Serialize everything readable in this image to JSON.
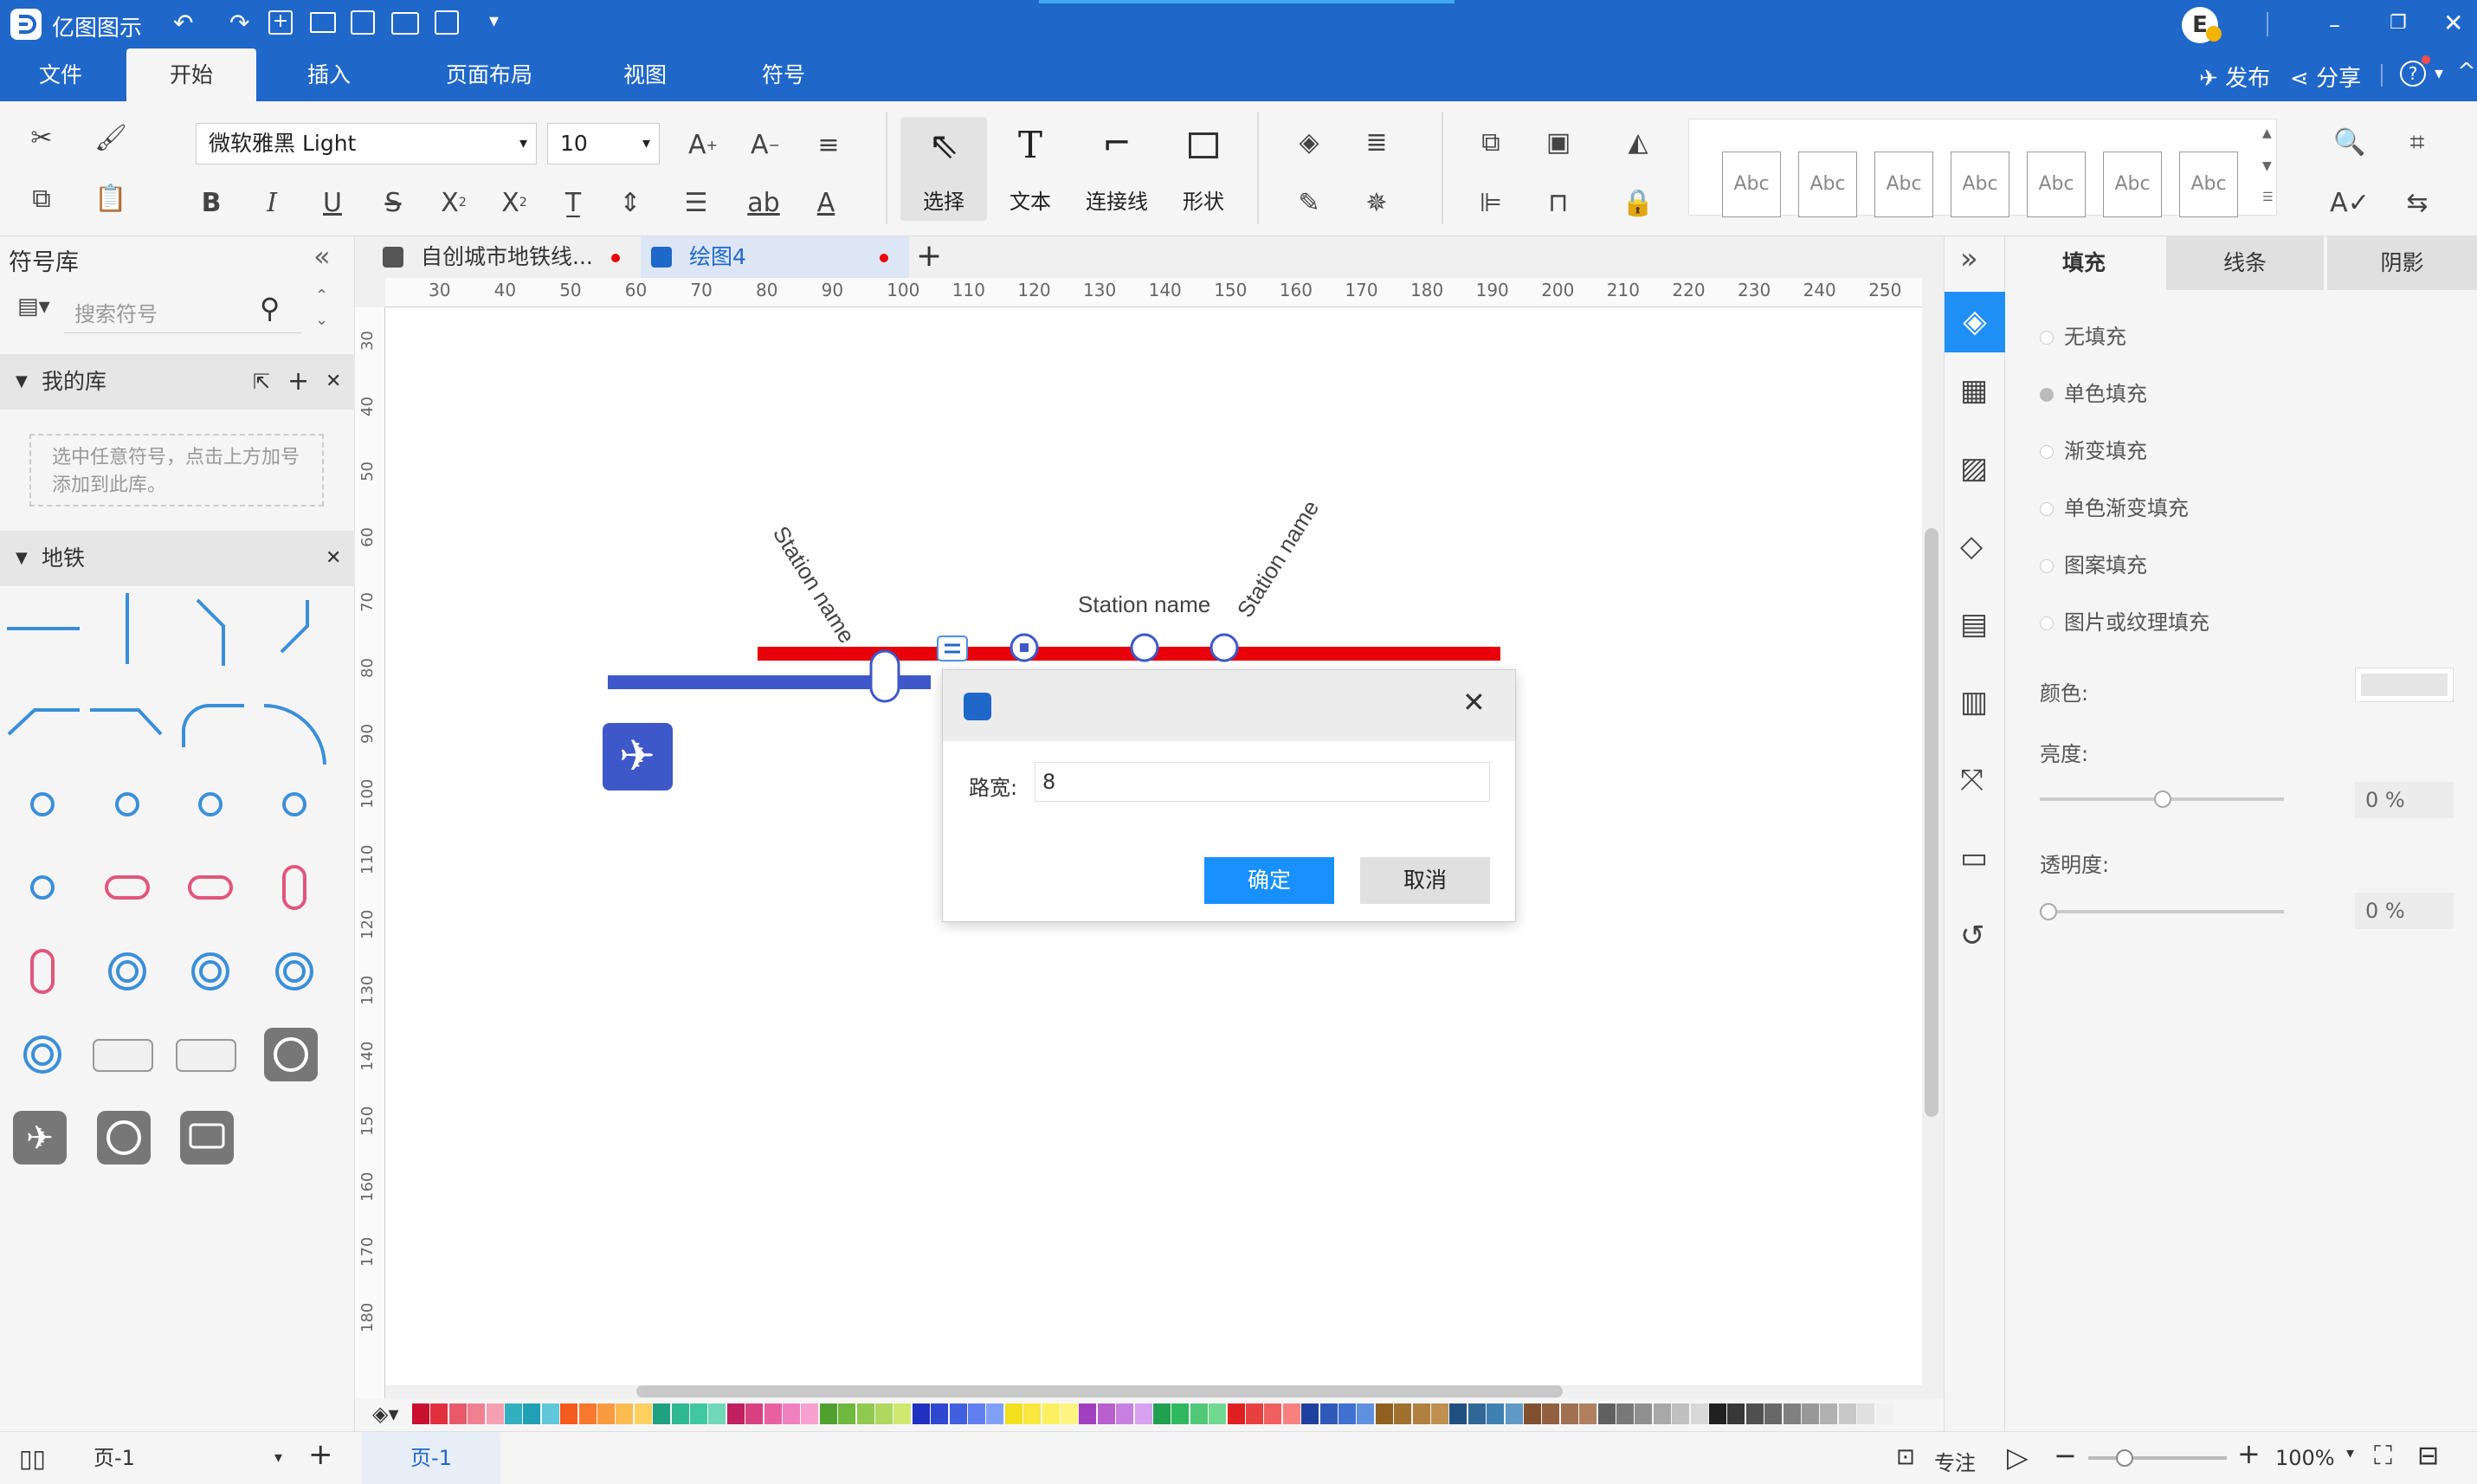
{
  "app": {
    "title": "亿图图示"
  },
  "user": {
    "initial": "E"
  },
  "menu": {
    "file": "文件",
    "tabs": [
      "开始",
      "插入",
      "页面布局",
      "视图",
      "符号"
    ],
    "publish": "发布",
    "share": "分享"
  },
  "toolbar": {
    "font": "微软雅黑 Light",
    "size": "10",
    "select": "选择",
    "text": "文本",
    "connector": "连接线",
    "shape": "形状",
    "styles": [
      "Abc",
      "Abc",
      "Abc",
      "Abc",
      "Abc",
      "Abc",
      "Abc"
    ]
  },
  "library": {
    "title": "符号库",
    "search_placeholder": "搜索符号",
    "my_library": "我的库",
    "my_library_hint": "选中任意符号，点击上方加号添加到此库。",
    "metro": "地铁"
  },
  "doc_tabs": [
    "自创城市地铁线...",
    "绘图4"
  ],
  "ruler": {
    "h": [
      "30",
      "40",
      "50",
      "60",
      "70",
      "80",
      "90",
      "100",
      "110",
      "120",
      "130",
      "140",
      "150",
      "160",
      "170",
      "180",
      "190",
      "200",
      "210",
      "220",
      "230",
      "240",
      "250"
    ],
    "v": [
      "30",
      "40",
      "50",
      "60",
      "70",
      "80",
      "90",
      "100",
      "110",
      "120",
      "130",
      "140",
      "150",
      "160",
      "170",
      "180"
    ]
  },
  "canvas": {
    "station_labels": [
      "Station name",
      "Station name",
      "Station name"
    ]
  },
  "dialog": {
    "field_label": "路宽:",
    "field_value": "8",
    "ok": "确定",
    "cancel": "取消"
  },
  "right_panel": {
    "tabs": [
      "填充",
      "线条",
      "阴影"
    ],
    "fill_options": [
      "无填充",
      "单色填充",
      "渐变填充",
      "单色渐变填充",
      "图案填充",
      "图片或纹理填充"
    ],
    "color_label": "颜色:",
    "brightness_label": "亮度:",
    "brightness_value": "0 %",
    "transparency_label": "透明度:",
    "transparency_value": "0 %"
  },
  "status": {
    "page_select": "页-1",
    "page_tab": "页-1",
    "focus": "专注",
    "zoom": "100%"
  },
  "colors": {
    "brand_blue": "#1f67c9",
    "line_red": "#e8000b",
    "line_blue": "#3e57c9",
    "ok_blue": "#1890ff"
  }
}
